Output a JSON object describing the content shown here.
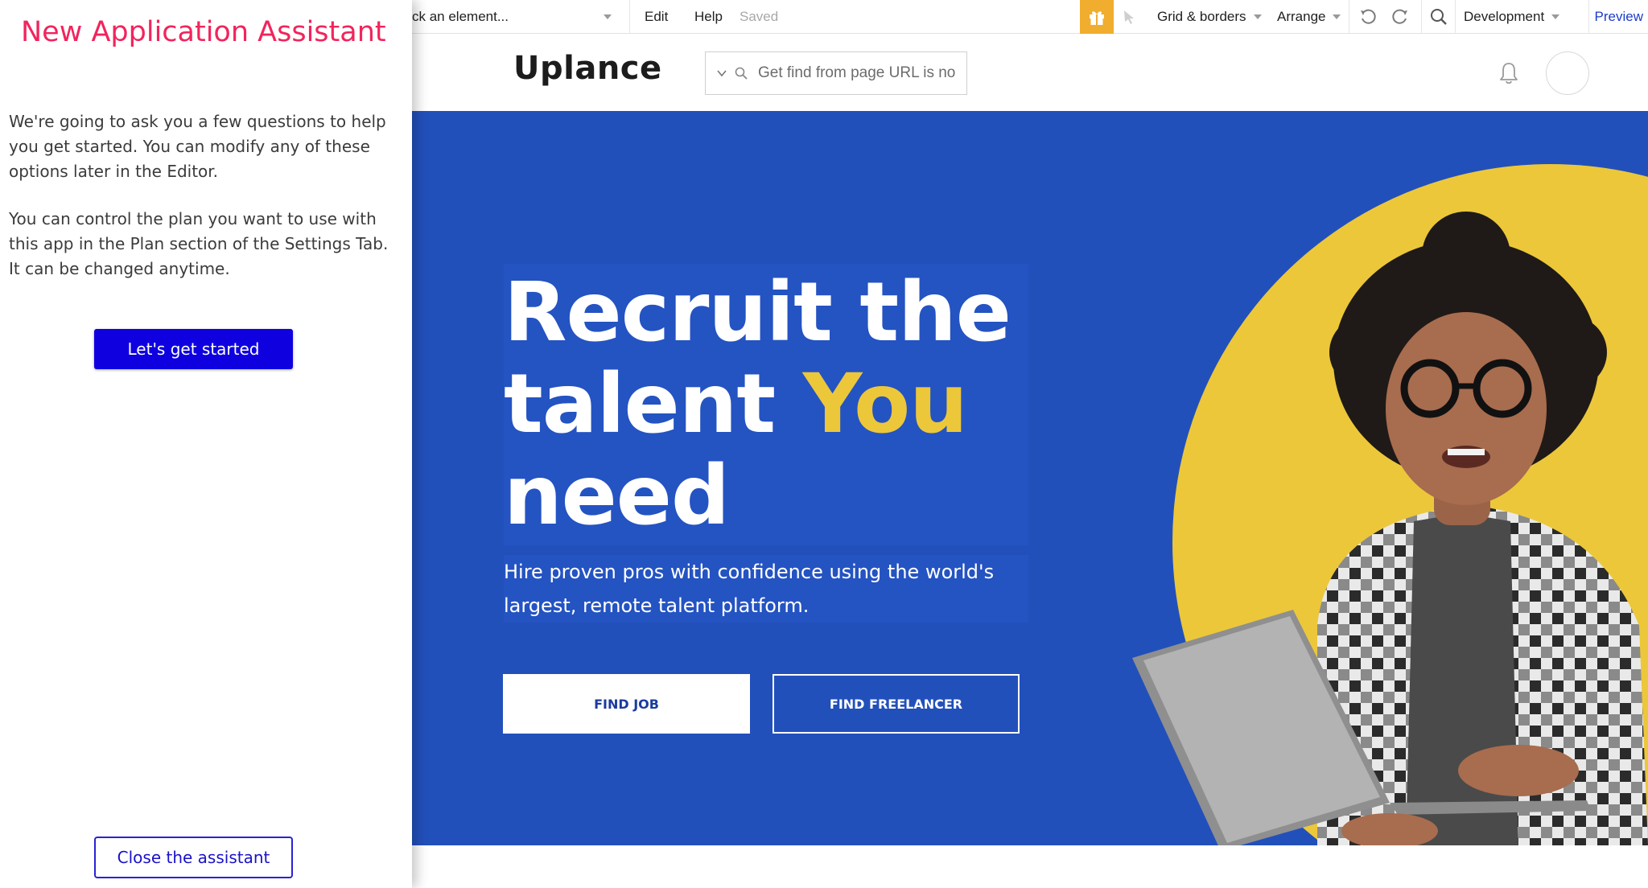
{
  "toolbar": {
    "element_picker": "ck an element...",
    "edit": "Edit",
    "help": "Help",
    "saved": "Saved",
    "gift_icon": "gift-icon",
    "grid_borders": "Grid & borders",
    "arrange": "Arrange",
    "development": "Development",
    "preview": "Preview"
  },
  "assistant": {
    "title": "New Application Assistant",
    "intro": "We're going to ask you a few questions to help you get started. You can modify any of these options later in the Editor.",
    "plan_note": "You can control the plan you want to use with this app in the Plan section of the Settings Tab. It can be changed anytime.",
    "start_label": "Let's get started",
    "close_label": "Close the assistant"
  },
  "page": {
    "logo": "Uplance",
    "search_placeholder": "Get find from page URL is no",
    "hero": {
      "headline_part1": "Recruit the talent ",
      "headline_highlight": "You",
      "headline_part2": " need",
      "subtitle": "Hire proven pros with confidence using the world's largest, remote talent platform.",
      "find_job": "FIND JOB",
      "find_freelancer": "FIND FREELANCER"
    }
  },
  "colors": {
    "hero_blue": "#2250bb",
    "accent_yellow": "#ecc73a",
    "assistant_title": "#f2245c",
    "primary_button": "#0f00e0",
    "gift_orange": "#f0ad2e"
  }
}
